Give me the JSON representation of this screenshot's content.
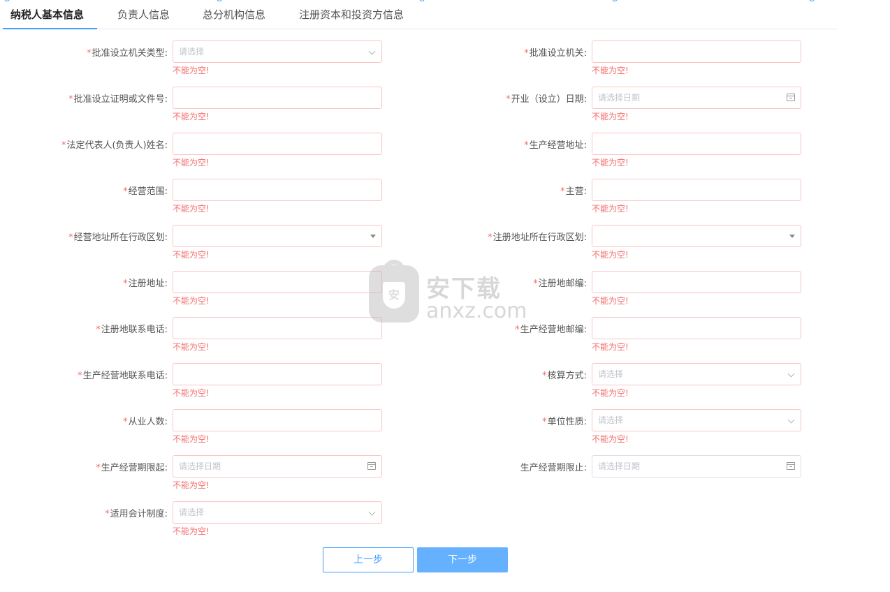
{
  "tabs": [
    {
      "label": "纳税人基本信息",
      "active": true
    },
    {
      "label": "负责人信息",
      "active": false
    },
    {
      "label": "总分机构信息",
      "active": false
    },
    {
      "label": "注册资本和投资方信息",
      "active": false
    }
  ],
  "form": {
    "required_mark": "*",
    "error_text": "不能为空!",
    "fields": [
      {
        "label": "批准设立机关类型:",
        "type": "select",
        "placeholder": "请选择",
        "required": true,
        "error": true
      },
      {
        "label": "批准设立机关:",
        "type": "text",
        "placeholder": "",
        "required": true,
        "error": true
      },
      {
        "label": "批准设立证明或文件号:",
        "type": "text",
        "placeholder": "",
        "required": true,
        "error": true
      },
      {
        "label": "开业（设立）日期:",
        "type": "date",
        "placeholder": "请选择日期",
        "required": true,
        "error": true
      },
      {
        "label": "法定代表人(负责人)姓名:",
        "type": "text",
        "placeholder": "",
        "required": true,
        "error": true
      },
      {
        "label": "生产经营地址:",
        "type": "text",
        "placeholder": "",
        "required": true,
        "error": true
      },
      {
        "label": "经营范围:",
        "type": "text",
        "placeholder": "",
        "required": true,
        "error": true
      },
      {
        "label": "主营:",
        "type": "text",
        "placeholder": "",
        "required": true,
        "error": true
      },
      {
        "label": "经营地址所在行政区划:",
        "type": "dropdown",
        "placeholder": "",
        "required": true,
        "error": true
      },
      {
        "label": "注册地址所在行政区划:",
        "type": "dropdown",
        "placeholder": "",
        "required": true,
        "error": true
      },
      {
        "label": "注册地址:",
        "type": "text",
        "placeholder": "",
        "required": true,
        "error": true
      },
      {
        "label": "注册地邮编:",
        "type": "text",
        "placeholder": "",
        "required": true,
        "error": true
      },
      {
        "label": "注册地联系电话:",
        "type": "text",
        "placeholder": "",
        "required": true,
        "error": true
      },
      {
        "label": "生产经营地邮编:",
        "type": "text",
        "placeholder": "",
        "required": true,
        "error": true
      },
      {
        "label": "生产经营地联系电话:",
        "type": "text",
        "placeholder": "",
        "required": true,
        "error": true
      },
      {
        "label": "核算方式:",
        "type": "select",
        "placeholder": "请选择",
        "required": true,
        "error": true
      },
      {
        "label": "从业人数:",
        "type": "text",
        "placeholder": "",
        "required": true,
        "error": true
      },
      {
        "label": "单位性质:",
        "type": "select",
        "placeholder": "请选择",
        "required": true,
        "error": true
      },
      {
        "label": "生产经营期限起:",
        "type": "date",
        "placeholder": "请选择日期",
        "required": true,
        "error": true
      },
      {
        "label": "生产经营期限止:",
        "type": "date",
        "placeholder": "请选择日期",
        "required": false,
        "error": false
      },
      {
        "label": "适用会计制度:",
        "type": "select",
        "placeholder": "请选择",
        "required": true,
        "error": true
      }
    ]
  },
  "buttons": {
    "prev": "上一步",
    "next": "下一步"
  },
  "watermark": {
    "text_cn": "安下载",
    "text_en": "anxz.com",
    "badge_char": "安"
  },
  "colors": {
    "accent": "#409eff",
    "error": "#f56c6c",
    "next_bg": "#66b1ff"
  }
}
